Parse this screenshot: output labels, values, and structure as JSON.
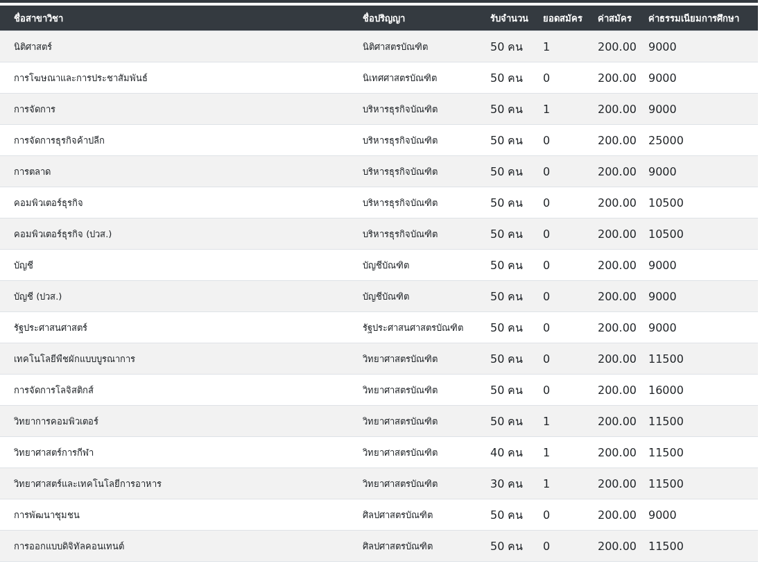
{
  "table": {
    "columns": [
      "ชื่อสาขาวิชา",
      "ชื่อปริญญา",
      "รับจำนวน",
      "ยอดสมัคร",
      "ค่าสมัคร",
      "ค่าธรรมเนียมการศึกษา"
    ],
    "rows": [
      [
        "นิติศาสตร์",
        "นิติศาสตรบัณฑิต",
        "50 คน",
        "1",
        "200.00",
        "9000"
      ],
      [
        "การโฆษณาและการประชาสัมพันธ์",
        "นิเทศศาสตรบัณฑิต",
        "50 คน",
        "0",
        "200.00",
        "9000"
      ],
      [
        "การจัดการ",
        "บริหารธุรกิจบัณฑิต",
        "50 คน",
        "1",
        "200.00",
        "9000"
      ],
      [
        "การจัดการธุรกิจค้าปลีก",
        "บริหารธุรกิจบัณฑิต",
        "50 คน",
        "0",
        "200.00",
        "25000"
      ],
      [
        "การตลาด",
        "บริหารธุรกิจบัณฑิต",
        "50 คน",
        "0",
        "200.00",
        "9000"
      ],
      [
        "คอมพิวเตอร์ธุรกิจ",
        "บริหารธุรกิจบัณฑิต",
        "50 คน",
        "0",
        "200.00",
        "10500"
      ],
      [
        "คอมพิวเตอร์ธุรกิจ (ปวส.)",
        "บริหารธุรกิจบัณฑิต",
        "50 คน",
        "0",
        "200.00",
        "10500"
      ],
      [
        "บัญชี",
        "บัญชีบัณฑิต",
        "50 คน",
        "0",
        "200.00",
        "9000"
      ],
      [
        "บัญชี (ปวส.)",
        "บัญชีบัณฑิต",
        "50 คน",
        "0",
        "200.00",
        "9000"
      ],
      [
        "รัฐประศาสนศาสตร์",
        "รัฐประศาสนศาสตรบัณฑิต",
        "50 คน",
        "0",
        "200.00",
        "9000"
      ],
      [
        "เทคโนโลยีพืชผักแบบบูรณาการ",
        "วิทยาศาสตรบัณฑิต",
        "50 คน",
        "0",
        "200.00",
        "11500"
      ],
      [
        "การจัดการโลจิสติกส์",
        "วิทยาศาสตรบัณฑิต",
        "50 คน",
        "0",
        "200.00",
        "16000"
      ],
      [
        "วิทยาการคอมพิวเตอร์",
        "วิทยาศาสตรบัณฑิต",
        "50 คน",
        "1",
        "200.00",
        "11500"
      ],
      [
        "วิทยาศาสตร์การกีฬา",
        "วิทยาศาสตรบัณฑิต",
        "40 คน",
        "1",
        "200.00",
        "11500"
      ],
      [
        "วิทยาศาสตร์และเทคโนโลยีการอาหาร",
        "วิทยาศาสตรบัณฑิต",
        "30 คน",
        "1",
        "200.00",
        "11500"
      ],
      [
        "การพัฒนาชุมชน",
        "ศิลปศาสตรบัณฑิต",
        "50 คน",
        "0",
        "200.00",
        "9000"
      ],
      [
        "การออกแบบดิจิทัลคอนเทนต์",
        "ศิลปศาสตรบัณฑิต",
        "50 คน",
        "0",
        "200.00",
        "11500"
      ]
    ]
  }
}
